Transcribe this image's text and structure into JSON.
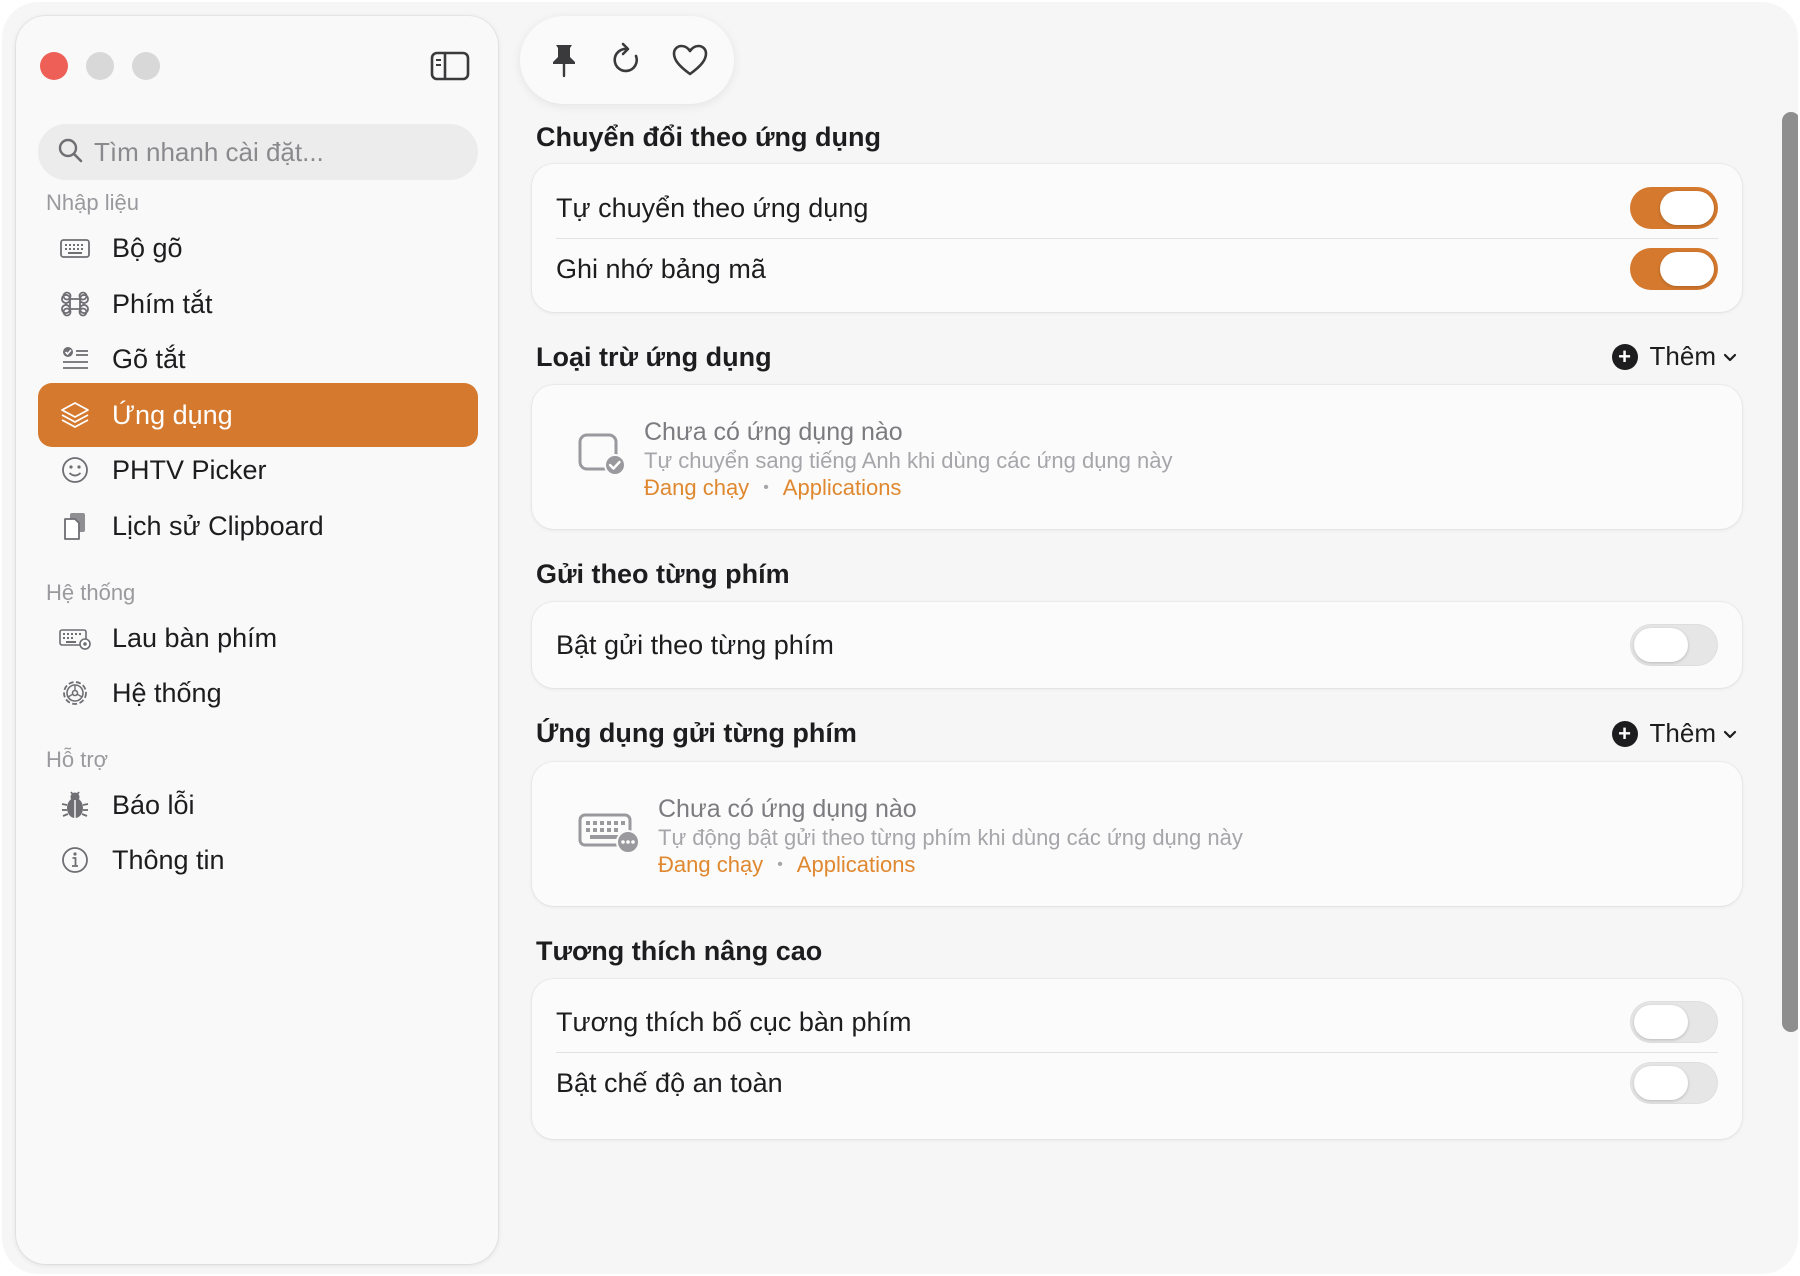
{
  "colors": {
    "accent": "#d4792e",
    "link": "#e0882f",
    "close": "#ee5f57"
  },
  "search": {
    "placeholder": "Tìm nhanh cài đặt..."
  },
  "sidebar": {
    "sections": [
      {
        "label": "Nhập liệu"
      },
      {
        "label": "Hệ thống"
      },
      {
        "label": "Hỗ trợ"
      }
    ],
    "items": [
      {
        "label": "Bộ gõ",
        "icon": "keyboard-icon"
      },
      {
        "label": "Phím tắt",
        "icon": "command-icon"
      },
      {
        "label": "Gõ tắt",
        "icon": "checklist-icon"
      },
      {
        "label": "Ứng dụng",
        "icon": "layers-icon",
        "active": true
      },
      {
        "label": "PHTV Picker",
        "icon": "smiley-icon"
      },
      {
        "label": "Lịch sử Clipboard",
        "icon": "clipboard-icon"
      },
      {
        "label": "Lau bàn phím",
        "icon": "keyboard-clean-icon"
      },
      {
        "label": "Hệ thống",
        "icon": "gear-icon"
      },
      {
        "label": "Báo lỗi",
        "icon": "bug-icon"
      },
      {
        "label": "Thông tin",
        "icon": "info-icon"
      }
    ]
  },
  "toolbar": {
    "icons": [
      "pin-icon",
      "refresh-icon",
      "heart-icon"
    ]
  },
  "main": {
    "app_switch": {
      "title": "Chuyển đổi theo ứng dụng",
      "rows": [
        {
          "label": "Tự chuyển theo ứng dụng",
          "on": true
        },
        {
          "label": "Ghi nhớ bảng mã",
          "on": true
        }
      ]
    },
    "exclude": {
      "title": "Loại trừ ứng dụng",
      "add_label": "Thêm",
      "empty_title": "Chưa có ứng dụng nào",
      "empty_desc": "Tự chuyển sang tiếng Anh khi dùng các ứng dụng này",
      "link_running": "Đang chạy",
      "link_apps": "Applications"
    },
    "send_key": {
      "title": "Gửi theo từng phím",
      "rows": [
        {
          "label": "Bật gửi theo từng phím",
          "on": false
        }
      ]
    },
    "send_key_apps": {
      "title": "Ứng dụng gửi từng phím",
      "add_label": "Thêm",
      "empty_title": "Chưa có ứng dụng nào",
      "empty_desc": "Tự động bật gửi theo từng phím khi dùng các ứng dụng này",
      "link_running": "Đang chạy",
      "link_apps": "Applications"
    },
    "advanced": {
      "title": "Tương thích nâng cao",
      "rows": [
        {
          "label": "Tương thích bố cục bàn phím",
          "on": false
        },
        {
          "label": "Bật chế độ an toàn",
          "on": false
        }
      ]
    }
  }
}
